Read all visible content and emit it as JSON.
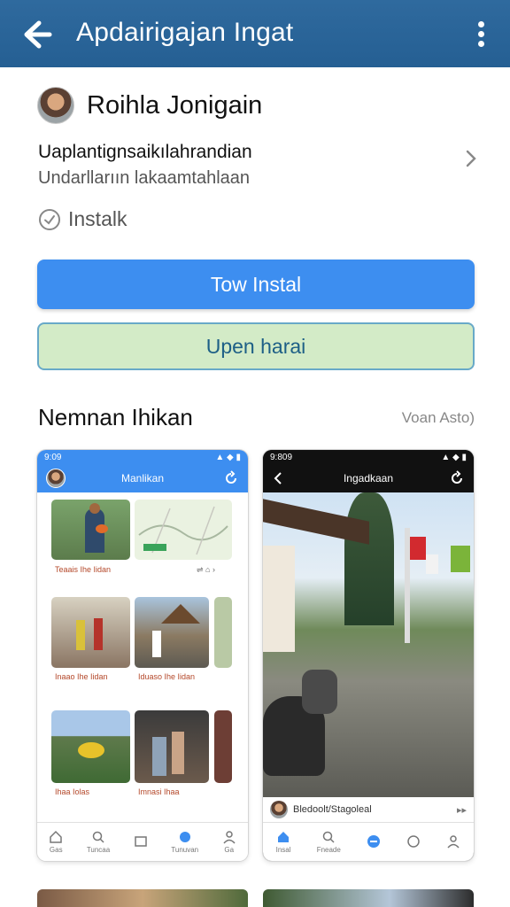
{
  "appbar": {
    "title": "Apdairigajan Ingat"
  },
  "profile": {
    "name": "Roihla Jonigain"
  },
  "description": {
    "line1": "Uaplantignsaikılahrandian",
    "line2": "Undarllarıın lakaamtahlaan"
  },
  "install_status": "Instalk",
  "buttons": {
    "primary": "Tow Instal",
    "secondary": "Upen harai"
  },
  "section": {
    "title": "Nemnan Ihikan",
    "meta": "Voan Asto)"
  },
  "screenshot_left": {
    "title": "Manlikan",
    "status_time": "9:09",
    "captions": [
      "Teaais Ihe Iidan",
      "Inaao Ihe Iidan",
      "Iduaso Ihe Iidan",
      "Ihaa Iolas",
      "Imnasi Ihaa"
    ],
    "nav": [
      "Gas",
      "Tuncaa",
      "",
      "Tunuvan",
      "Ga"
    ]
  },
  "screenshot_right": {
    "title": "Ingadkaan",
    "status_time": "9:809",
    "author": "Bledoolt/Stagoleal",
    "more": "▸▸",
    "nav": [
      "Insal",
      "Fneade",
      "",
      "",
      ""
    ]
  },
  "colors": {
    "appbar": "#2f6a9e",
    "primary": "#3d8ef0",
    "secondary_bg": "#d3ebc7"
  }
}
